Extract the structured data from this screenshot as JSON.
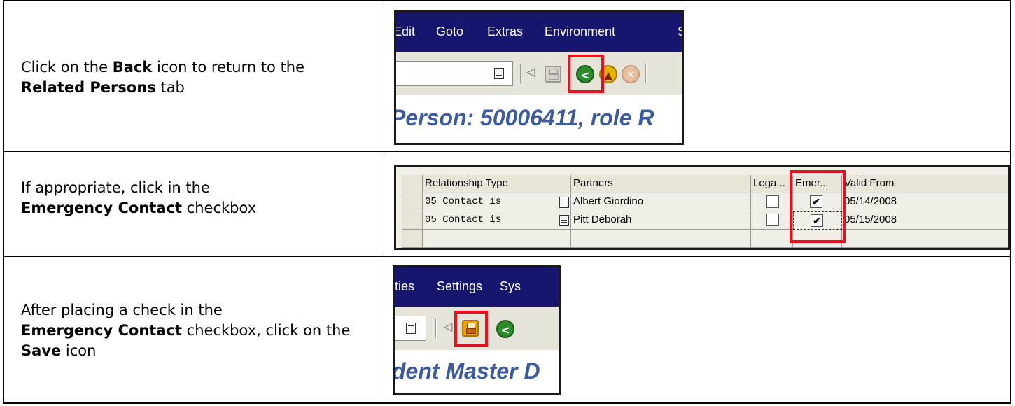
{
  "steps": [
    {
      "pre": "Click on the ",
      "b1": "Back",
      "mid": " icon to return to the ",
      "b2": "Related Persons",
      "post": " tab"
    },
    {
      "pre": "If appropriate, click in the ",
      "b1": "Emergency Contact",
      "post": " checkbox"
    },
    {
      "pre": "After placing a check in the ",
      "b1": "Emergency Contact",
      "mid": " checkbox, click on the ",
      "b2": "Save",
      "post": " icon"
    }
  ],
  "shot1": {
    "menu": [
      "Edit",
      "Goto",
      "Extras",
      "Environment",
      "S"
    ],
    "title": "Person: 50006411, role R",
    "icons": [
      "command-field-icon",
      "back-arrow-icon",
      "save-icon",
      "back-icon",
      "exit-icon",
      "cancel-icon"
    ],
    "highlight_color": "#e8101e"
  },
  "shot2": {
    "columns": [
      "Relationship Type",
      "Partners",
      "Lega...",
      "Emer...",
      "Valid From"
    ],
    "rows": [
      {
        "type": "05 Contact is",
        "partner": "Albert Giordino",
        "legal": false,
        "emergency": true,
        "valid_from": "05/14/2008"
      },
      {
        "type": "05 Contact is",
        "partner": "Pitt Deborah",
        "legal": false,
        "emergency": true,
        "valid_from": "05/15/2008"
      }
    ],
    "check_mark": "✔"
  },
  "shot3": {
    "menu": [
      "ities",
      "Settings",
      "Sys"
    ],
    "title": "dent Master D"
  },
  "colors": {
    "menubar": "#16166e",
    "toolbar": "#e6e3d8",
    "title_text": "#3c5aa0",
    "back_green": "#2f8a2a",
    "exit_yellow": "#e8b400"
  }
}
